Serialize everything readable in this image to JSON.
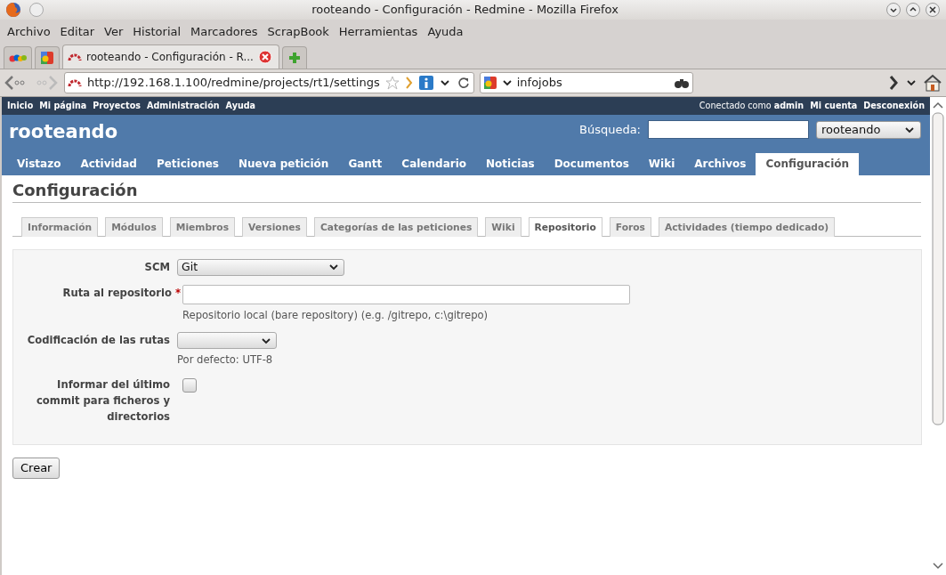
{
  "window": {
    "title": "rooteando - Configuración - Redmine - Mozilla Firefox"
  },
  "menu_bar": [
    "Archivo",
    "Editar",
    "Ver",
    "Historial",
    "Marcadores",
    "ScrapBook",
    "Herramientas",
    "Ayuda"
  ],
  "browser_tabs": [
    {
      "kind": "auction",
      "selected": false
    },
    {
      "kind": "google",
      "selected": false
    },
    {
      "kind": "page",
      "label": "rooteando - Configuración - R...",
      "selected": true
    },
    {
      "kind": "new",
      "selected": false
    }
  ],
  "address_bar": {
    "url": "http://192.168.1.100/redmine/projects/rt1/settings"
  },
  "search_box": {
    "value": "infojobs"
  },
  "top_menu": {
    "left": [
      "Inicio",
      "Mi página",
      "Proyectos",
      "Administración",
      "Ayuda"
    ],
    "logged_in": "Conectado como **admin**",
    "right": [
      "Mi cuenta",
      "Desconexión"
    ]
  },
  "header": {
    "project_title": "rooteando",
    "search_label": "Búsqueda:",
    "project_select": "rooteando"
  },
  "main_menu": [
    {
      "label": "Vistazo",
      "selected": false
    },
    {
      "label": "Actividad",
      "selected": false
    },
    {
      "label": "Peticiones",
      "selected": false
    },
    {
      "label": "Nueva petición",
      "selected": false
    },
    {
      "label": "Gantt",
      "selected": false
    },
    {
      "label": "Calendario",
      "selected": false
    },
    {
      "label": "Noticias",
      "selected": false
    },
    {
      "label": "Documentos",
      "selected": false
    },
    {
      "label": "Wiki",
      "selected": false
    },
    {
      "label": "Archivos",
      "selected": false
    },
    {
      "label": "Configuración",
      "selected": true
    }
  ],
  "page_title": "Configuración",
  "settings_tabs": [
    {
      "label": "Información",
      "selected": false
    },
    {
      "label": "Módulos",
      "selected": false
    },
    {
      "label": "Miembros",
      "selected": false
    },
    {
      "label": "Versiones",
      "selected": false
    },
    {
      "label": "Categorías de las peticiones",
      "selected": false
    },
    {
      "label": "Wiki",
      "selected": false
    },
    {
      "label": "Repositorio",
      "selected": true
    },
    {
      "label": "Foros",
      "selected": false
    },
    {
      "label": "Actividades (tiempo dedicado)",
      "selected": false
    }
  ],
  "form": [
    {
      "kind": "select",
      "label": "SCM",
      "value": "Git"
    },
    {
      "kind": "text",
      "label": "Ruta al repositorio",
      "required_mark": "*",
      "hint": "Repositorio local (bare repository) (e.g. /gitrepo, c:\\gitrepo)"
    },
    {
      "kind": "select-small",
      "label": "Codificación de las rutas",
      "hint": "Por defecto: UTF-8"
    },
    {
      "kind": "checkbox",
      "label": "Informar del último commit para ficheros y directorios",
      "checked": false
    }
  ],
  "submit_button": "Crear"
}
